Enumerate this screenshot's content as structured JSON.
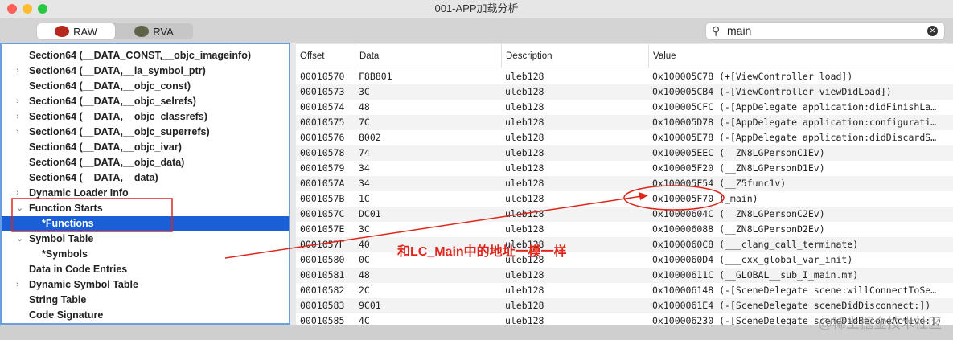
{
  "window": {
    "title": "001-APP加载分析"
  },
  "toolbar": {
    "raw_label": "RAW",
    "rva_label": "RVA",
    "search_value": "main"
  },
  "tree": [
    {
      "label": "Section64 (__DATA_CONST,__objc_imageinfo)",
      "indent": 1,
      "chevron": ""
    },
    {
      "label": "Section64 (__DATA,__la_symbol_ptr)",
      "indent": 1,
      "chevron": ">"
    },
    {
      "label": "Section64 (__DATA,__objc_const)",
      "indent": 1,
      "chevron": ""
    },
    {
      "label": "Section64 (__DATA,__objc_selrefs)",
      "indent": 1,
      "chevron": ">"
    },
    {
      "label": "Section64 (__DATA,__objc_classrefs)",
      "indent": 1,
      "chevron": ">"
    },
    {
      "label": "Section64 (__DATA,__objc_superrefs)",
      "indent": 1,
      "chevron": ">"
    },
    {
      "label": "Section64 (__DATA,__objc_ivar)",
      "indent": 1,
      "chevron": ""
    },
    {
      "label": "Section64 (__DATA,__objc_data)",
      "indent": 1,
      "chevron": ""
    },
    {
      "label": "Section64 (__DATA,__data)",
      "indent": 1,
      "chevron": ""
    },
    {
      "label": "Dynamic Loader Info",
      "indent": 1,
      "chevron": ">"
    },
    {
      "label": "Function Starts",
      "indent": 1,
      "chevron": "v"
    },
    {
      "label": "*Functions",
      "indent": 2,
      "chevron": "",
      "selected": true
    },
    {
      "label": "Symbol Table",
      "indent": 1,
      "chevron": "v"
    },
    {
      "label": "*Symbols",
      "indent": 2,
      "chevron": ""
    },
    {
      "label": "Data in Code Entries",
      "indent": 1,
      "chevron": ""
    },
    {
      "label": "Dynamic Symbol Table",
      "indent": 1,
      "chevron": ">"
    },
    {
      "label": "String Table",
      "indent": 1,
      "chevron": ""
    },
    {
      "label": "Code Signature",
      "indent": 1,
      "chevron": ""
    }
  ],
  "table": {
    "columns": [
      "Offset",
      "Data",
      "Description",
      "Value"
    ],
    "rows": [
      [
        "00010570",
        "F8B801",
        "uleb128",
        "0x100005C78 (+[ViewController load])"
      ],
      [
        "00010573",
        "3C",
        "uleb128",
        "0x100005CB4 (-[ViewController viewDidLoad])"
      ],
      [
        "00010574",
        "48",
        "uleb128",
        "0x100005CFC (-[AppDelegate application:didFinishLa…"
      ],
      [
        "00010575",
        "7C",
        "uleb128",
        "0x100005D78 (-[AppDelegate application:configurati…"
      ],
      [
        "00010576",
        "8002",
        "uleb128",
        "0x100005E78 (-[AppDelegate application:didDiscardS…"
      ],
      [
        "00010578",
        "74",
        "uleb128",
        "0x100005EEC (__ZN8LGPersonC1Ev)"
      ],
      [
        "00010579",
        "34",
        "uleb128",
        "0x100005F20 (__ZN8LGPersonD1Ev)"
      ],
      [
        "0001057A",
        "34",
        "uleb128",
        "0x100005F54 (__Z5func1v)"
      ],
      [
        "0001057B",
        "1C",
        "uleb128",
        "0x100005F70 (_main)"
      ],
      [
        "0001057C",
        "DC01",
        "uleb128",
        "0x10000604C (__ZN8LGPersonC2Ev)"
      ],
      [
        "0001057E",
        "3C",
        "uleb128",
        "0x100006088 (__ZN8LGPersonD2Ev)"
      ],
      [
        "0001057F",
        "40",
        "uleb128",
        "0x1000060C8 (___clang_call_terminate)"
      ],
      [
        "00010580",
        "0C",
        "uleb128",
        "0x1000060D4 (___cxx_global_var_init)"
      ],
      [
        "00010581",
        "48",
        "uleb128",
        "0x10000611C (__GLOBAL__sub_I_main.mm)"
      ],
      [
        "00010582",
        "2C",
        "uleb128",
        "0x100006148 (-[SceneDelegate scene:willConnectToSe…"
      ],
      [
        "00010583",
        "9C01",
        "uleb128",
        "0x1000061E4 (-[SceneDelegate sceneDidDisconnect:])"
      ],
      [
        "00010585",
        "4C",
        "uleb128",
        "0x100006230 (-[SceneDelegate sceneDidBecomeActive:])"
      ]
    ]
  },
  "annotation": {
    "text": "和LC_Main中的地址一模一样",
    "color": "#e0261b"
  },
  "watermark": "@稀土掘金技术社区"
}
